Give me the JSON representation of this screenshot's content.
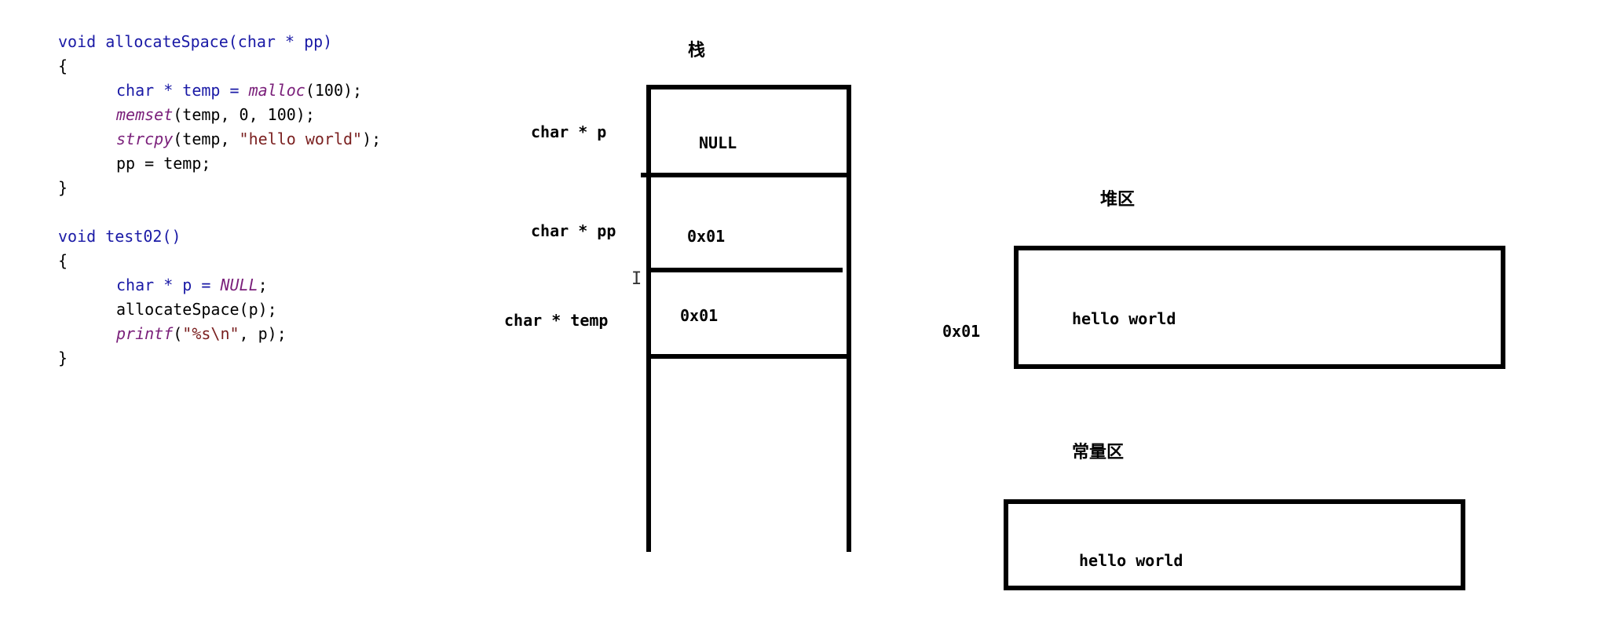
{
  "code": {
    "func1_sig": "void allocateSpace(char * pp)",
    "brace_open1": "{",
    "l1_type": "char * temp = ",
    "l1_fn": "malloc",
    "l1_rest": "(100);",
    "l2_fn": "memset",
    "l2_rest": "(temp, 0, 100);",
    "l3_fn": "strcpy",
    "l3_mid": "(temp, ",
    "l3_str": "\"hello world\"",
    "l3_rest": ");",
    "l4": "pp = temp;",
    "brace_close1": "}",
    "func2_sig": "void test02()",
    "brace_open2": "{",
    "m1_type": "char * p = ",
    "m1_val": "NULL",
    "m1_rest": ";",
    "m2": "allocateSpace(p);",
    "m3_fn": "printf",
    "m3_mid": "(",
    "m3_str": "\"%s\\n\"",
    "m3_rest": ", p);",
    "brace_close2": "}"
  },
  "stack": {
    "title": "栈",
    "rows": [
      {
        "label": "char * p",
        "value": "NULL"
      },
      {
        "label": "char * pp",
        "value": "0x01"
      },
      {
        "label": "char * temp",
        "value": "0x01"
      }
    ]
  },
  "heap": {
    "title": "堆区",
    "address": "0x01",
    "content": "hello world"
  },
  "constant": {
    "title": "常量区",
    "content": "hello world"
  },
  "cursor_glyph": "I"
}
